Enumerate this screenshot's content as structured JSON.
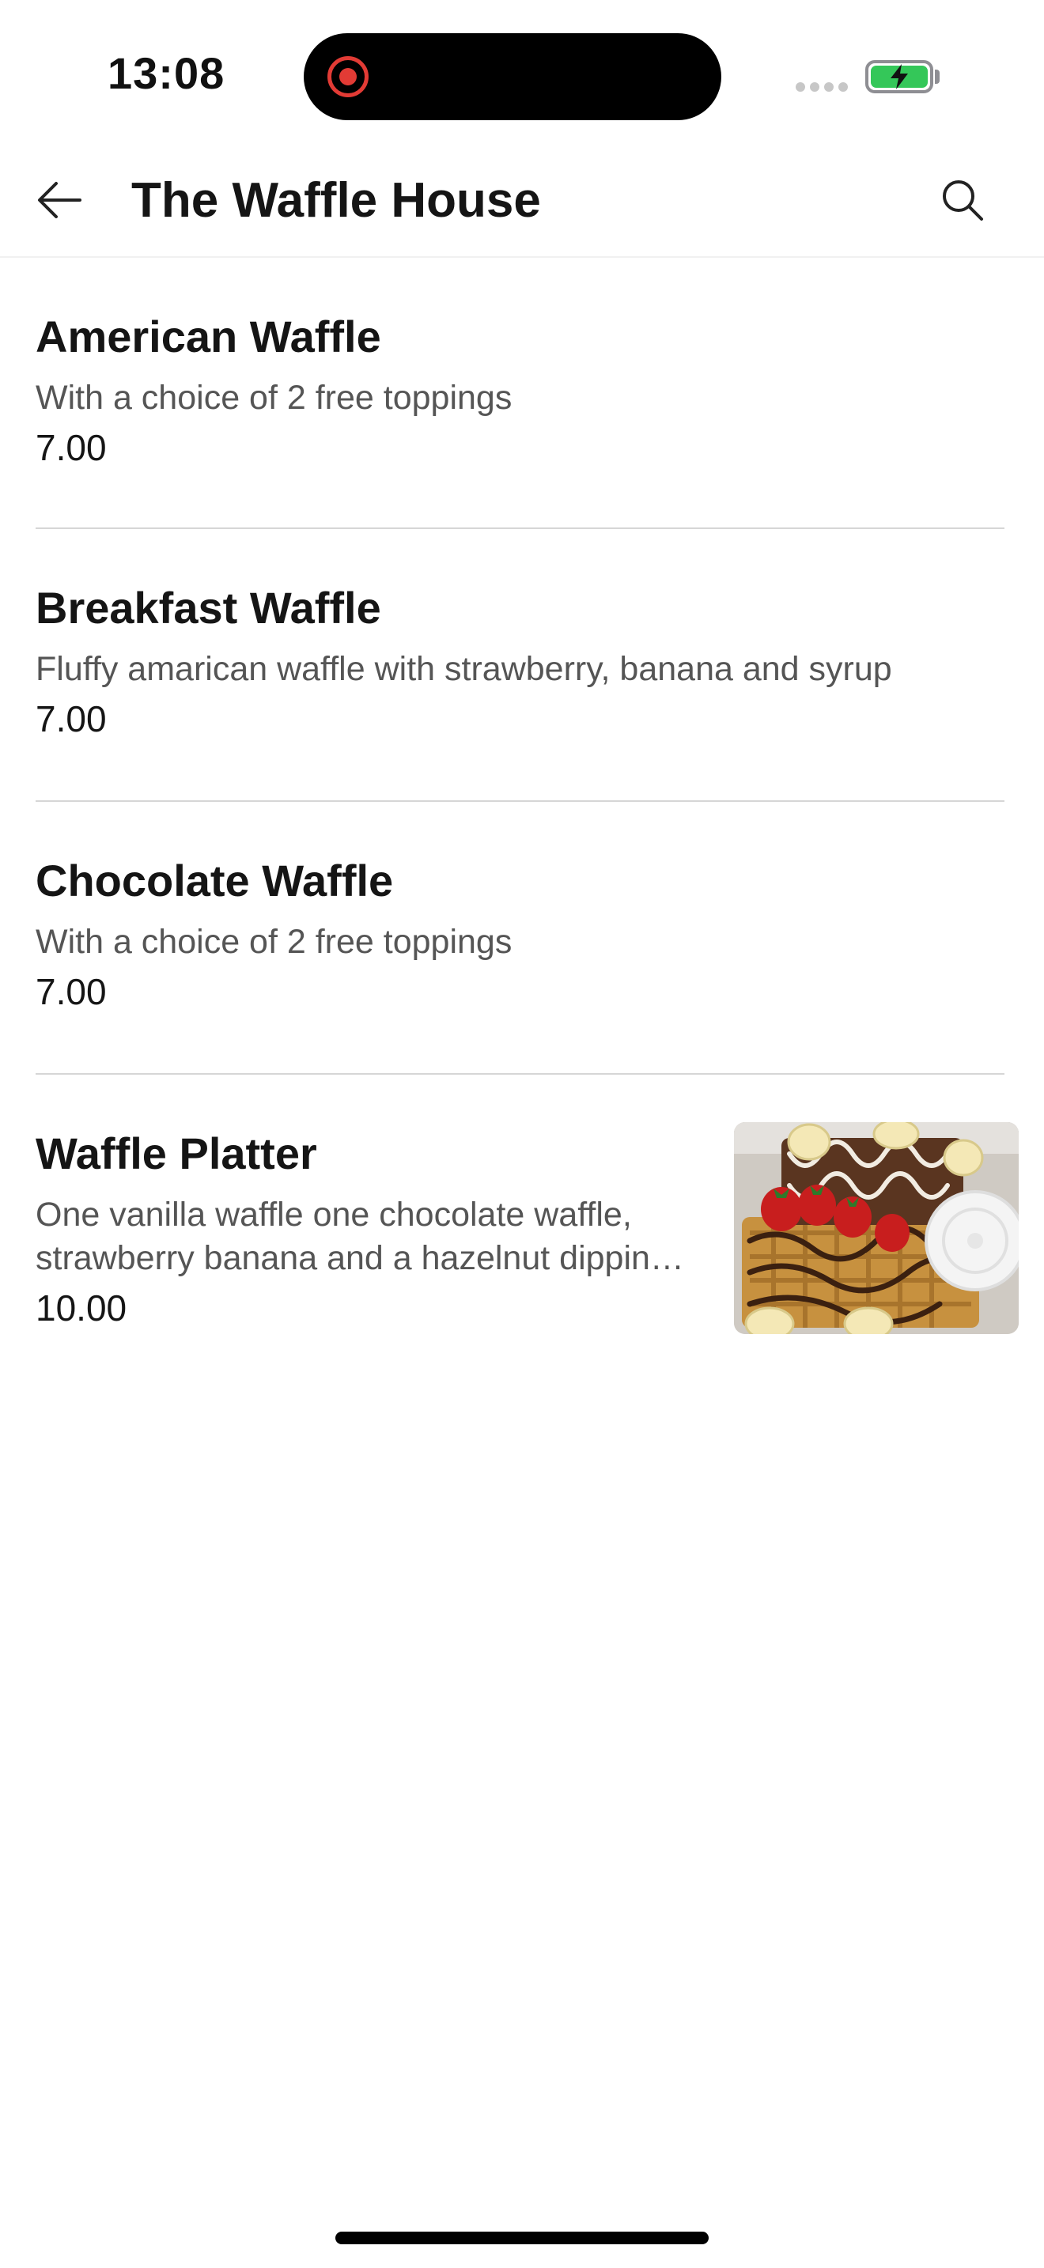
{
  "status_bar": {
    "time": "13:08"
  },
  "header": {
    "title": "The Waffle House",
    "back_icon": "arrow-left-icon",
    "search_icon": "search-icon"
  },
  "menu": {
    "items": [
      {
        "name": "American Waffle",
        "description": "With a choice of 2 free toppings",
        "price": "7.00"
      },
      {
        "name": "Breakfast Waffle",
        "description": "Fluffy amarican waffle with strawberry, banana and syrup",
        "price": "7.00"
      },
      {
        "name": "Chocolate Waffle",
        "description": "With a choice of 2 free toppings",
        "price": "7.00"
      },
      {
        "name": "Waffle Platter",
        "description_line1": "One vanilla waffle one chocolate waffle,",
        "description_line2": "strawberry banana and a hazelnut dippin…",
        "price": "10.00",
        "image": "waffle-platter-photo"
      }
    ]
  },
  "colors": {
    "battery_green": "#34c759",
    "record_red": "#e23b35",
    "divider": "#d6d6d6"
  }
}
